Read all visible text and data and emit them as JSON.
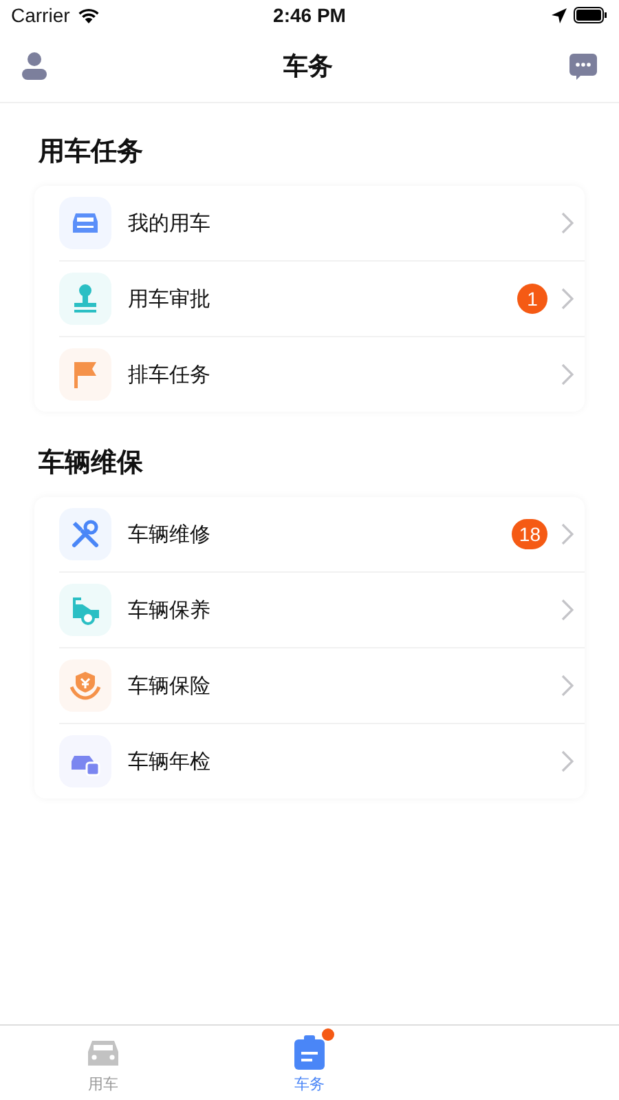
{
  "status_bar": {
    "carrier": "Carrier",
    "time": "2:46 PM"
  },
  "nav": {
    "title": "车务"
  },
  "sections": [
    {
      "title": "用车任务",
      "items": [
        {
          "kind": "car",
          "color": "#5b8ff9",
          "label": "我的用车"
        },
        {
          "kind": "stamp",
          "color": "#2bbfc4",
          "label": "用车审批",
          "badge": "1"
        },
        {
          "kind": "flag",
          "color": "#f5924a",
          "label": "排车任务"
        }
      ]
    },
    {
      "title": "车辆维保",
      "items": [
        {
          "kind": "tools",
          "color": "#4a86f7",
          "label": "车辆维修",
          "badge": "18"
        },
        {
          "kind": "service",
          "color": "#2bbfc4",
          "label": "车辆保养"
        },
        {
          "kind": "insurance",
          "color": "#f5924a",
          "label": "车辆保险"
        },
        {
          "kind": "inspection",
          "color": "#7b86f0",
          "label": "车辆年检"
        }
      ]
    }
  ],
  "tabbar": [
    {
      "label": "用车",
      "selected": false,
      "dot": false
    },
    {
      "label": "车务",
      "selected": true,
      "dot": true
    }
  ]
}
